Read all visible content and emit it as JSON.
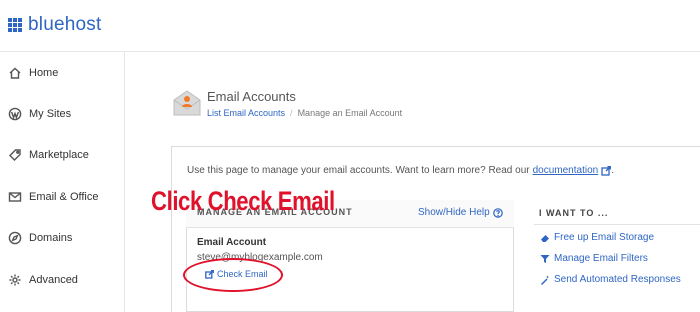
{
  "app": {
    "brand": "bluehost",
    "brand_color": "#2f66c4"
  },
  "sidebar": {
    "items": [
      {
        "label": "Home",
        "icon": "home-icon"
      },
      {
        "label": "My Sites",
        "icon": "wordpress-icon"
      },
      {
        "label": "Marketplace",
        "icon": "tag-icon"
      },
      {
        "label": "Email & Office",
        "icon": "mail-icon"
      },
      {
        "label": "Domains",
        "icon": "compass-icon"
      },
      {
        "label": "Advanced",
        "icon": "gear-icon"
      }
    ]
  },
  "header": {
    "title": "Email Accounts",
    "breadcrumb": {
      "link": "List Email Accounts",
      "separator": "/",
      "current": "Manage an Email Account"
    }
  },
  "intro": {
    "text": "Use this page to manage your email accounts. Want to learn more? Read our",
    "link": "documentation",
    "suffix": "."
  },
  "manage": {
    "title": "MANAGE AN EMAIL ACCOUNT",
    "help_link": "Show/Hide Help",
    "account_label": "Email Account",
    "account_email": "steve@myblogexample.com",
    "check_email": "Check Email"
  },
  "i_want_to": {
    "title": "I WANT TO ...",
    "actions": [
      {
        "label": "Free up Email Storage",
        "icon": "eraser-icon"
      },
      {
        "label": "Manage Email Filters",
        "icon": "filter-icon"
      },
      {
        "label": "Send Automated Responses",
        "icon": "magic-wand-icon"
      }
    ]
  },
  "annotation": {
    "callout": "Click Check Email",
    "color": "#e0112b"
  }
}
